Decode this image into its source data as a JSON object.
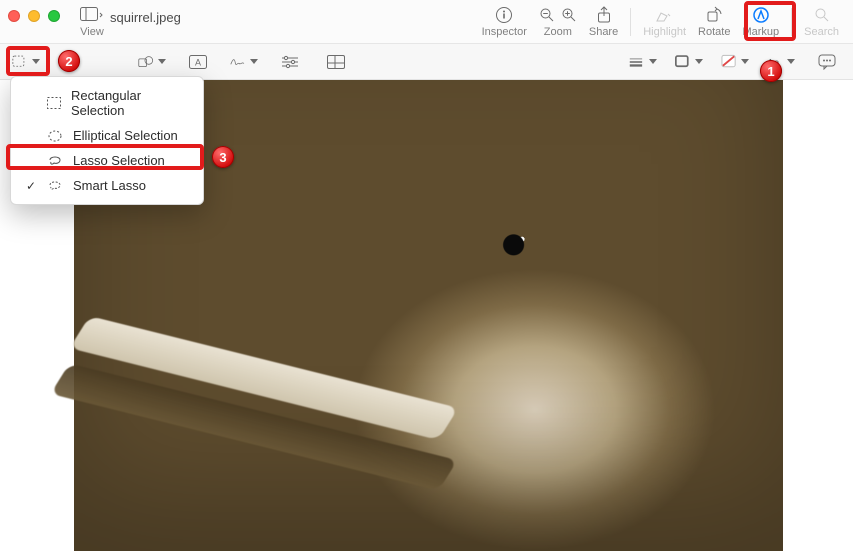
{
  "window": {
    "filename": "squirrel.jpeg"
  },
  "toolbar": {
    "view_label": "View",
    "inspector_label": "Inspector",
    "zoom_label": "Zoom",
    "share_label": "Share",
    "highlight_label": "Highlight",
    "rotate_label": "Rotate",
    "markup_label": "Markup",
    "search_label": "Search"
  },
  "selection_menu": {
    "items": [
      {
        "label": "Rectangular Selection",
        "checked": false
      },
      {
        "label": "Elliptical Selection",
        "checked": false
      },
      {
        "label": "Lasso Selection",
        "checked": false
      },
      {
        "label": "Smart Lasso",
        "checked": true
      }
    ]
  },
  "callouts": {
    "n1": "1",
    "n2": "2",
    "n3": "3"
  }
}
